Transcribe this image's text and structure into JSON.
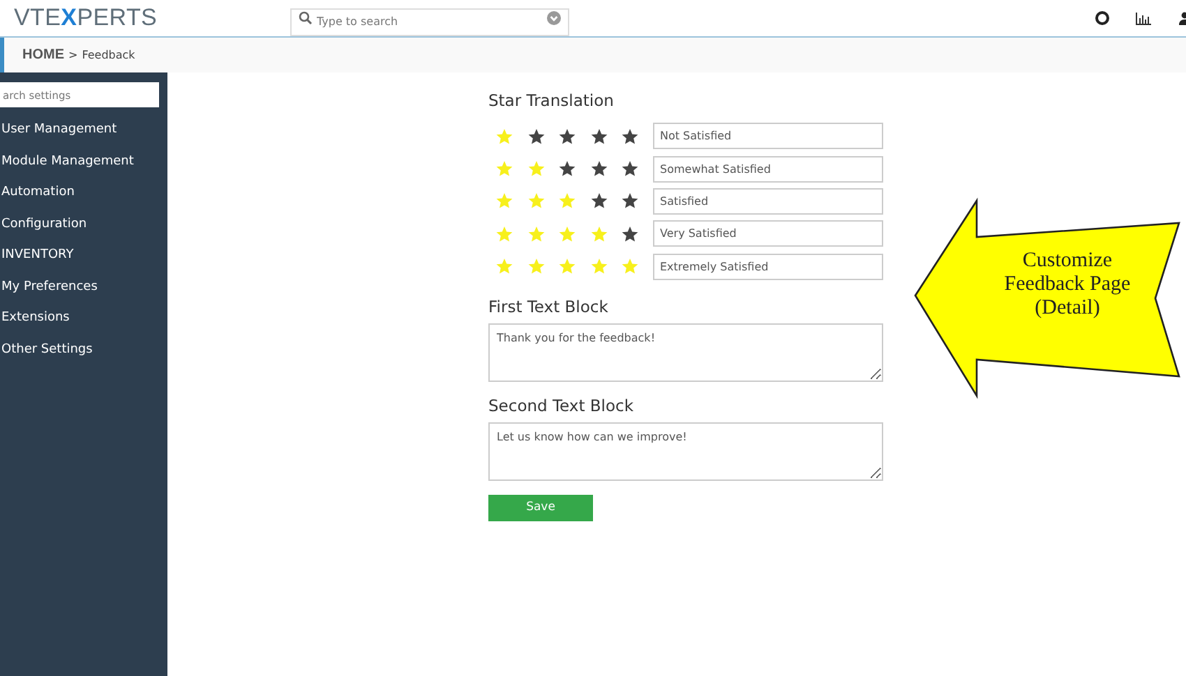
{
  "header": {
    "logo": {
      "before": "VTE",
      "accent": "X",
      "after": "PERTS"
    },
    "search": {
      "placeholder": "Type to search"
    }
  },
  "breadcrumb": {
    "home": "HOME",
    "separator": ">",
    "current": "Feedback"
  },
  "sidebar": {
    "search": {
      "placeholder": "arch settings"
    },
    "items": [
      {
        "label": "User Management"
      },
      {
        "label": "Module Management"
      },
      {
        "label": "Automation"
      },
      {
        "label": "Configuration"
      },
      {
        "label": "INVENTORY"
      },
      {
        "label": "My Preferences"
      },
      {
        "label": "Extensions"
      },
      {
        "label": "Other Settings"
      }
    ]
  },
  "star_translation": {
    "title": "Star Translation",
    "rows": [
      {
        "stars": 1,
        "value": "Not Satisfied"
      },
      {
        "stars": 2,
        "value": "Somewhat Satisfied"
      },
      {
        "stars": 3,
        "value": "Satisfied"
      },
      {
        "stars": 4,
        "value": "Very Satisfied"
      },
      {
        "stars": 5,
        "value": "Extremely Satisfied"
      }
    ]
  },
  "text_blocks": [
    {
      "title": "First Text Block",
      "value": "Thank you for the feedback!"
    },
    {
      "title": "Second Text Block",
      "value": "Let us know how can we improve!"
    }
  ],
  "save_button": "Save",
  "callout": {
    "lines": [
      "Customize",
      "Feedback Page",
      "(Detail)"
    ]
  }
}
